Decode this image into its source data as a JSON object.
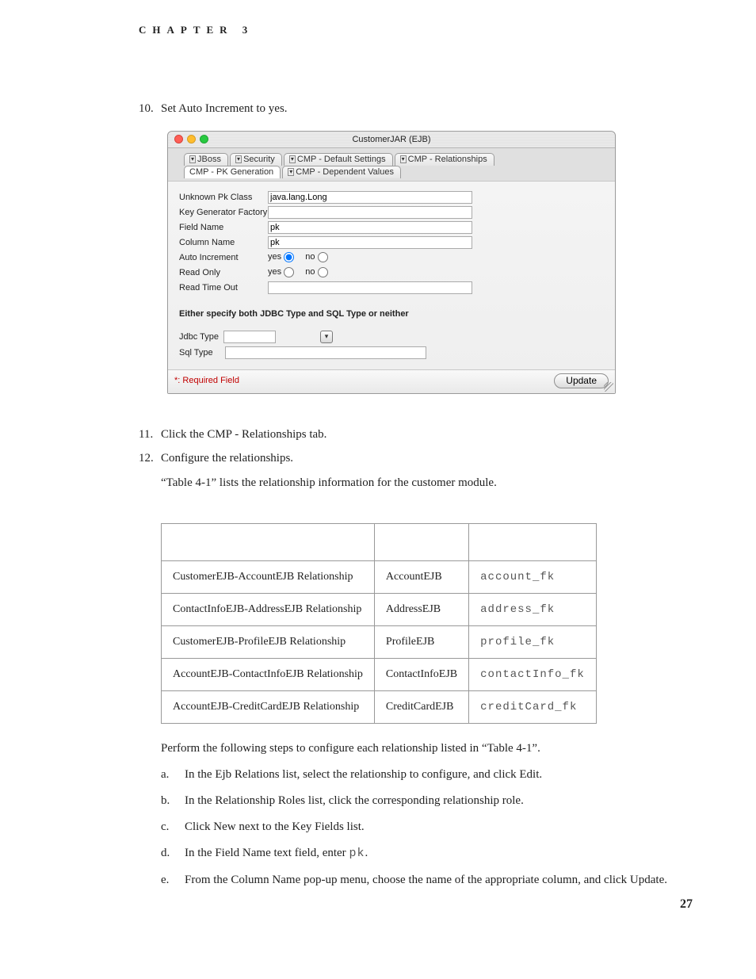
{
  "header": {
    "chapter_label": "CHAPTER 3"
  },
  "steps": {
    "s10": "Set Auto Increment to yes.",
    "s11": "Click the CMP - Relationships tab.",
    "s12": "Configure the relationships.",
    "s12_note": "“Table 4-1” lists the relationship information for the customer module.",
    "after_table": "Perform the following steps to configure each relationship listed in “Table 4-1”.",
    "subs": {
      "a": "In the Ejb Relations list, select the relationship to configure, and click Edit.",
      "b": "In the Relationship Roles list, click the corresponding relationship role.",
      "c": "Click New next to the Key Fields list.",
      "d_pre": "In the Field Name text field, enter ",
      "d_code": "pk",
      "d_post": ".",
      "e": "From the Column Name pop-up menu, choose the name of the appropriate column, and click Update."
    }
  },
  "screenshot": {
    "title": "CustomerJAR (EJB)",
    "tabs_row1": [
      "JBoss",
      "Security",
      "CMP - Default Settings",
      "CMP - Relationships"
    ],
    "tabs_row2": [
      "CMP - PK Generation",
      "CMP - Dependent Values"
    ],
    "selected_tab_row": 2,
    "selected_tab_index": 0,
    "fields": {
      "unknown_pk_class_label": "Unknown Pk Class",
      "unknown_pk_class_value": "java.lang.Long",
      "key_gen_factory_label": "Key Generator Factory",
      "key_gen_factory_value": "",
      "field_name_label": "Field Name",
      "field_name_value": "pk",
      "column_name_label": "Column Name",
      "column_name_value": "pk",
      "auto_increment_label": "Auto Increment",
      "auto_increment_value": "yes",
      "read_only_label": "Read Only",
      "read_only_value": "",
      "read_time_out_label": "Read Time Out",
      "read_time_out_value": ""
    },
    "radio_yes": "yes",
    "radio_no": "no",
    "section_note": "Either specify both JDBC Type and SQL Type or neither",
    "jdbc_type_label": "Jdbc Type",
    "jdbc_type_value": "",
    "sql_type_label": "Sql Type",
    "sql_type_value": "",
    "required_note": "*: Required Field",
    "update_button": "Update"
  },
  "table": {
    "headers": [
      "",
      "",
      ""
    ],
    "rows": [
      {
        "rel": "CustomerEJB-AccountEJB Relationship",
        "role": "AccountEJB",
        "col": "account_fk"
      },
      {
        "rel": "ContactInfoEJB-AddressEJB Relationship",
        "role": "AddressEJB",
        "col": "address_fk"
      },
      {
        "rel": "CustomerEJB-ProfileEJB Relationship",
        "role": "ProfileEJB",
        "col": "profile_fk"
      },
      {
        "rel": "AccountEJB-ContactInfoEJB Relationship",
        "role": "ContactInfoEJB",
        "col": "contactInfo_fk"
      },
      {
        "rel": "AccountEJB-CreditCardEJB Relationship",
        "role": "CreditCardEJB",
        "col": "creditCard_fk"
      }
    ]
  },
  "page_number": "27"
}
